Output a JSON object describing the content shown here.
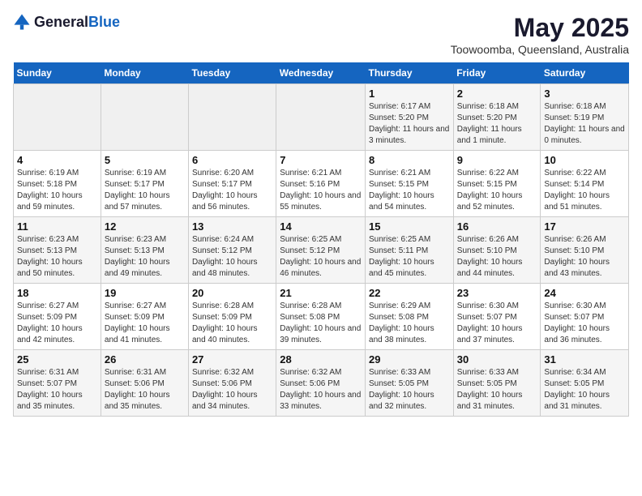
{
  "header": {
    "logo_general": "General",
    "logo_blue": "Blue",
    "title": "May 2025",
    "subtitle": "Toowoomba, Queensland, Australia"
  },
  "columns": [
    "Sunday",
    "Monday",
    "Tuesday",
    "Wednesday",
    "Thursday",
    "Friday",
    "Saturday"
  ],
  "weeks": [
    [
      {
        "day": "",
        "info": ""
      },
      {
        "day": "",
        "info": ""
      },
      {
        "day": "",
        "info": ""
      },
      {
        "day": "",
        "info": ""
      },
      {
        "day": "1",
        "info": "Sunrise: 6:17 AM\nSunset: 5:20 PM\nDaylight: 11 hours and 3 minutes."
      },
      {
        "day": "2",
        "info": "Sunrise: 6:18 AM\nSunset: 5:20 PM\nDaylight: 11 hours and 1 minute."
      },
      {
        "day": "3",
        "info": "Sunrise: 6:18 AM\nSunset: 5:19 PM\nDaylight: 11 hours and 0 minutes."
      }
    ],
    [
      {
        "day": "4",
        "info": "Sunrise: 6:19 AM\nSunset: 5:18 PM\nDaylight: 10 hours and 59 minutes."
      },
      {
        "day": "5",
        "info": "Sunrise: 6:19 AM\nSunset: 5:17 PM\nDaylight: 10 hours and 57 minutes."
      },
      {
        "day": "6",
        "info": "Sunrise: 6:20 AM\nSunset: 5:17 PM\nDaylight: 10 hours and 56 minutes."
      },
      {
        "day": "7",
        "info": "Sunrise: 6:21 AM\nSunset: 5:16 PM\nDaylight: 10 hours and 55 minutes."
      },
      {
        "day": "8",
        "info": "Sunrise: 6:21 AM\nSunset: 5:15 PM\nDaylight: 10 hours and 54 minutes."
      },
      {
        "day": "9",
        "info": "Sunrise: 6:22 AM\nSunset: 5:15 PM\nDaylight: 10 hours and 52 minutes."
      },
      {
        "day": "10",
        "info": "Sunrise: 6:22 AM\nSunset: 5:14 PM\nDaylight: 10 hours and 51 minutes."
      }
    ],
    [
      {
        "day": "11",
        "info": "Sunrise: 6:23 AM\nSunset: 5:13 PM\nDaylight: 10 hours and 50 minutes."
      },
      {
        "day": "12",
        "info": "Sunrise: 6:23 AM\nSunset: 5:13 PM\nDaylight: 10 hours and 49 minutes."
      },
      {
        "day": "13",
        "info": "Sunrise: 6:24 AM\nSunset: 5:12 PM\nDaylight: 10 hours and 48 minutes."
      },
      {
        "day": "14",
        "info": "Sunrise: 6:25 AM\nSunset: 5:12 PM\nDaylight: 10 hours and 46 minutes."
      },
      {
        "day": "15",
        "info": "Sunrise: 6:25 AM\nSunset: 5:11 PM\nDaylight: 10 hours and 45 minutes."
      },
      {
        "day": "16",
        "info": "Sunrise: 6:26 AM\nSunset: 5:10 PM\nDaylight: 10 hours and 44 minutes."
      },
      {
        "day": "17",
        "info": "Sunrise: 6:26 AM\nSunset: 5:10 PM\nDaylight: 10 hours and 43 minutes."
      }
    ],
    [
      {
        "day": "18",
        "info": "Sunrise: 6:27 AM\nSunset: 5:09 PM\nDaylight: 10 hours and 42 minutes."
      },
      {
        "day": "19",
        "info": "Sunrise: 6:27 AM\nSunset: 5:09 PM\nDaylight: 10 hours and 41 minutes."
      },
      {
        "day": "20",
        "info": "Sunrise: 6:28 AM\nSunset: 5:09 PM\nDaylight: 10 hours and 40 minutes."
      },
      {
        "day": "21",
        "info": "Sunrise: 6:28 AM\nSunset: 5:08 PM\nDaylight: 10 hours and 39 minutes."
      },
      {
        "day": "22",
        "info": "Sunrise: 6:29 AM\nSunset: 5:08 PM\nDaylight: 10 hours and 38 minutes."
      },
      {
        "day": "23",
        "info": "Sunrise: 6:30 AM\nSunset: 5:07 PM\nDaylight: 10 hours and 37 minutes."
      },
      {
        "day": "24",
        "info": "Sunrise: 6:30 AM\nSunset: 5:07 PM\nDaylight: 10 hours and 36 minutes."
      }
    ],
    [
      {
        "day": "25",
        "info": "Sunrise: 6:31 AM\nSunset: 5:07 PM\nDaylight: 10 hours and 35 minutes."
      },
      {
        "day": "26",
        "info": "Sunrise: 6:31 AM\nSunset: 5:06 PM\nDaylight: 10 hours and 35 minutes."
      },
      {
        "day": "27",
        "info": "Sunrise: 6:32 AM\nSunset: 5:06 PM\nDaylight: 10 hours and 34 minutes."
      },
      {
        "day": "28",
        "info": "Sunrise: 6:32 AM\nSunset: 5:06 PM\nDaylight: 10 hours and 33 minutes."
      },
      {
        "day": "29",
        "info": "Sunrise: 6:33 AM\nSunset: 5:05 PM\nDaylight: 10 hours and 32 minutes."
      },
      {
        "day": "30",
        "info": "Sunrise: 6:33 AM\nSunset: 5:05 PM\nDaylight: 10 hours and 31 minutes."
      },
      {
        "day": "31",
        "info": "Sunrise: 6:34 AM\nSunset: 5:05 PM\nDaylight: 10 hours and 31 minutes."
      }
    ]
  ]
}
